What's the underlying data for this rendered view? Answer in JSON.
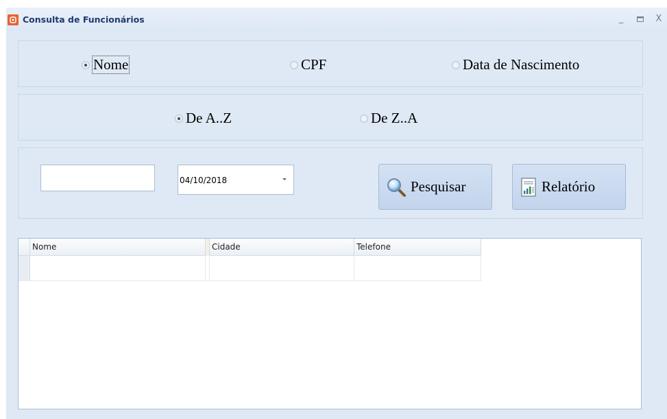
{
  "window": {
    "title": "Consulta de Funcionários",
    "controls": {
      "minimize": "_",
      "maximize": "▬",
      "close": "X"
    }
  },
  "search_field_options": [
    {
      "label": "Nome",
      "checked": true
    },
    {
      "label": "CPF",
      "checked": false
    },
    {
      "label": "Data de Nascimento",
      "checked": false
    }
  ],
  "sort_options": [
    {
      "label": "De A..Z",
      "checked": true
    },
    {
      "label": "De Z..A",
      "checked": false
    }
  ],
  "search": {
    "text_value": "",
    "date_value": "04/10/2018"
  },
  "buttons": {
    "search_label": "Pesquisar",
    "search_icon": "magnifier-icon",
    "report_label": "Relatório",
    "report_icon": "report-chart-icon"
  },
  "grid": {
    "columns": [
      "Nome",
      "Cidade",
      "Telefone"
    ],
    "rows": [
      [
        "",
        "",
        ""
      ]
    ]
  }
}
